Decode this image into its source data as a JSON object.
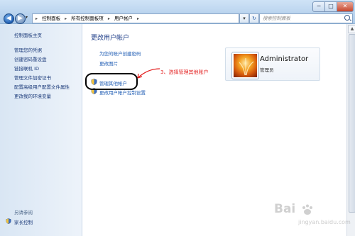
{
  "window": {
    "caption_min": "─",
    "caption_max": "□",
    "caption_close": "✕"
  },
  "nav": {
    "back_glyph": "◀",
    "forward_glyph": "▶",
    "dropdown_glyph": "▾",
    "refresh_glyph": "↻",
    "address_dropdown_glyph": "▾"
  },
  "breadcrumb": [
    "控制面板",
    "所有控制面板项",
    "用户帐户"
  ],
  "breadcrumb_separator": "▸",
  "search": {
    "placeholder": "搜索控制面板"
  },
  "sidebar": {
    "home": "控制面板主页",
    "items": [
      "管理您的凭据",
      "创建密码重设盘",
      "链接联机 ID",
      "管理文件加密证书",
      "配置高级用户配置文件属性",
      "更改我的环境变量"
    ],
    "see_also_header": "另请参阅",
    "family_safety": "家长控制"
  },
  "main": {
    "title": "更改用户帐户",
    "tasks": {
      "create_password": "为您的帐户创建密码",
      "change_picture": "更改图片",
      "manage_other": "管理其他帐户",
      "uac_settings": "更改用户帐户控制设置"
    }
  },
  "annotation": {
    "text": "3、选择管理其他账户",
    "color": "#e31d1d"
  },
  "account": {
    "name": "Administrator",
    "role": "管理员"
  },
  "watermark": {
    "brand": "Bai",
    "subtitle": "jingyan.baidu.com"
  },
  "colors": {
    "link": "#1d5bb3",
    "title": "#1a3a86",
    "annotation": "#e31d1d"
  }
}
